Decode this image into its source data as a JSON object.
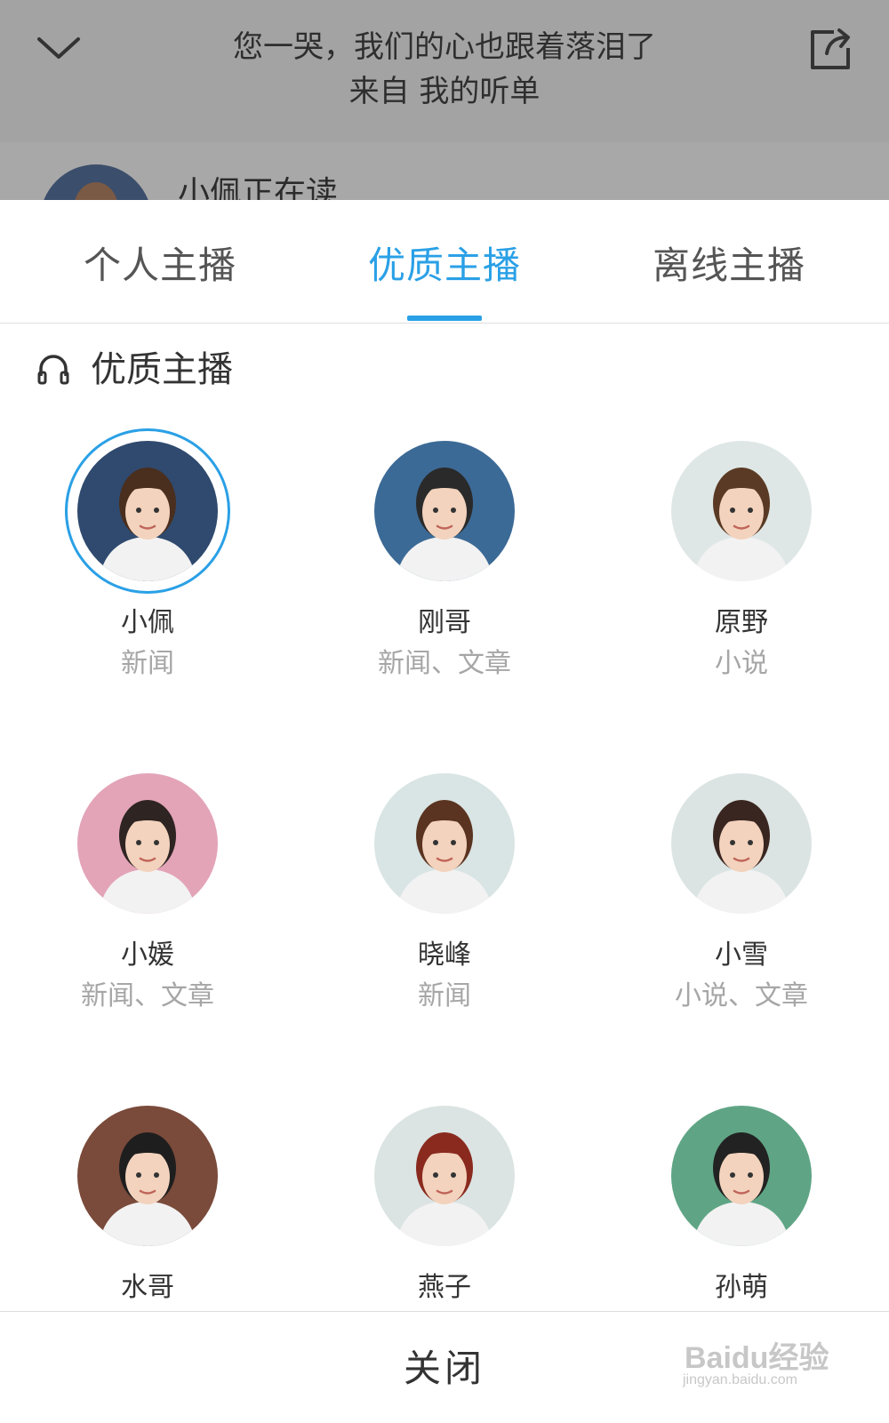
{
  "header": {
    "title": "您一哭，我们的心也跟着落泪了",
    "subtitle": "来自 我的听单",
    "now_reading": "小佩正在读"
  },
  "tabs": [
    {
      "label": "个人主播",
      "active": false
    },
    {
      "label": "优质主播",
      "active": true
    },
    {
      "label": "离线主播",
      "active": false
    }
  ],
  "section": {
    "title": "优质主播",
    "icon": "headphones-icon"
  },
  "anchors": [
    {
      "name": "小佩",
      "categories": "新闻",
      "selected": true,
      "bg": "#2f4a6e"
    },
    {
      "name": "刚哥",
      "categories": "新闻、文章",
      "selected": false,
      "bg": "#3c6a96"
    },
    {
      "name": "原野",
      "categories": "小说",
      "selected": false,
      "bg": "#dfe7e6"
    },
    {
      "name": "小媛",
      "categories": "新闻、文章",
      "selected": false,
      "bg": "#e3a4b8"
    },
    {
      "name": "晓峰",
      "categories": "新闻",
      "selected": false,
      "bg": "#d9e4e4"
    },
    {
      "name": "小雪",
      "categories": "小说、文章",
      "selected": false,
      "bg": "#dbe4e3"
    },
    {
      "name": "水哥",
      "categories": "",
      "selected": false,
      "bg": "#7a4a3a"
    },
    {
      "name": "燕子",
      "categories": "",
      "selected": false,
      "bg": "#dbe4e3"
    },
    {
      "name": "孙萌",
      "categories": "",
      "selected": false,
      "bg": "#5fa585"
    }
  ],
  "footer": {
    "close_label": "关闭"
  },
  "watermark": {
    "brand": "Baidu经验",
    "url": "jingyan.baidu.com"
  },
  "colors": {
    "accent": "#2aa0e6"
  }
}
